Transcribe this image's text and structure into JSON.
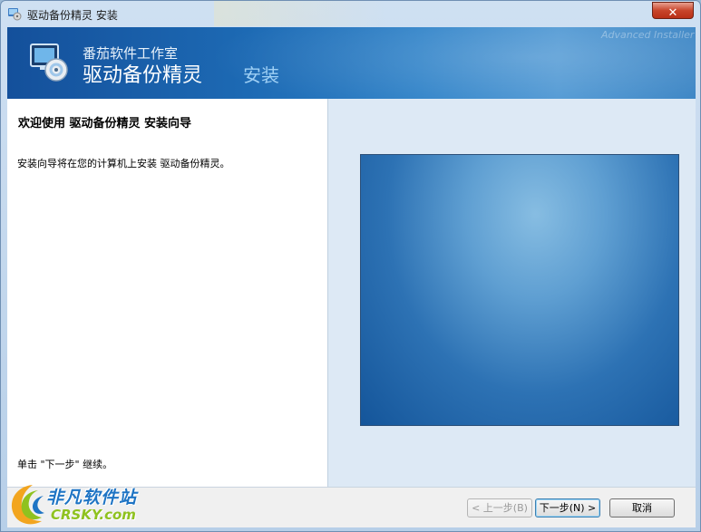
{
  "window": {
    "title": "驱动备份精灵 安装",
    "close_label": "✕"
  },
  "banner": {
    "studio": "番茄软件工作室",
    "product": "驱动备份精灵",
    "action": "安装",
    "vendor": "Advanced Installer"
  },
  "content": {
    "heading": "欢迎使用 驱动备份精灵 安装向导",
    "description": "安装向导将在您的计算机上安装 驱动备份精灵。",
    "continue_hint": "单击 \"下一步\" 继续。"
  },
  "footer": {
    "back_label": "< 上一步(B)",
    "back_enabled": false,
    "next_label": "下一步(N) >",
    "cancel_label": "取消"
  },
  "watermark": {
    "cn": "非凡软件站",
    "en": "CRSKY.com"
  },
  "colors": {
    "banner": "#1d6ab4",
    "close": "#c8452b",
    "right_pane": "#dde9f5"
  }
}
